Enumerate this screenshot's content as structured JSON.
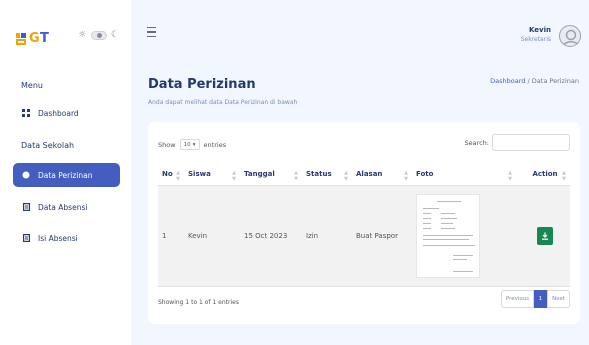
{
  "brand": {
    "text_g": "G",
    "text_t": "T"
  },
  "sidebar": {
    "menu_title": "Menu",
    "items": [
      {
        "label": "Dashboard"
      },
      {
        "label": "Data Perizinan"
      },
      {
        "label": "Data Absensi"
      },
      {
        "label": "Isi Absensi"
      }
    ],
    "section_label": "Data Sekolah"
  },
  "user": {
    "name": "Kevin",
    "role": "Sekretaris"
  },
  "page": {
    "title": "Data Perizinan",
    "subtitle": "Anda dapat melihat data Data Perizinan di bawah",
    "breadcrumb_home": "Dashboard",
    "breadcrumb_sep": "/",
    "breadcrumb_current": "Data Perizinan"
  },
  "table_controls": {
    "show_label": "Show",
    "entries_value": "10",
    "entries_label": "entries",
    "search_label": "Search:"
  },
  "table": {
    "headers": [
      "No",
      "Siswa",
      "Tanggal",
      "Status",
      "Alasan",
      "Foto",
      "Action"
    ],
    "rows": [
      {
        "no": "1",
        "siswa": "Kevin",
        "tanggal": "15 Oct 2023",
        "status": "Izin",
        "alasan": "Buat Paspor"
      }
    ]
  },
  "footer": {
    "showing": "Showing 1 to 1 of 1 entries",
    "prev": "Previous",
    "page": "1",
    "next": "Next"
  },
  "colors": {
    "accent": "#435ebe",
    "download": "#198754",
    "bg": "#f2f7ff"
  },
  "icons": [
    "grid-icon",
    "dot-icon",
    "book-icon",
    "sun-icon",
    "moon-icon",
    "menu-icon",
    "user-icon",
    "download-icon"
  ]
}
